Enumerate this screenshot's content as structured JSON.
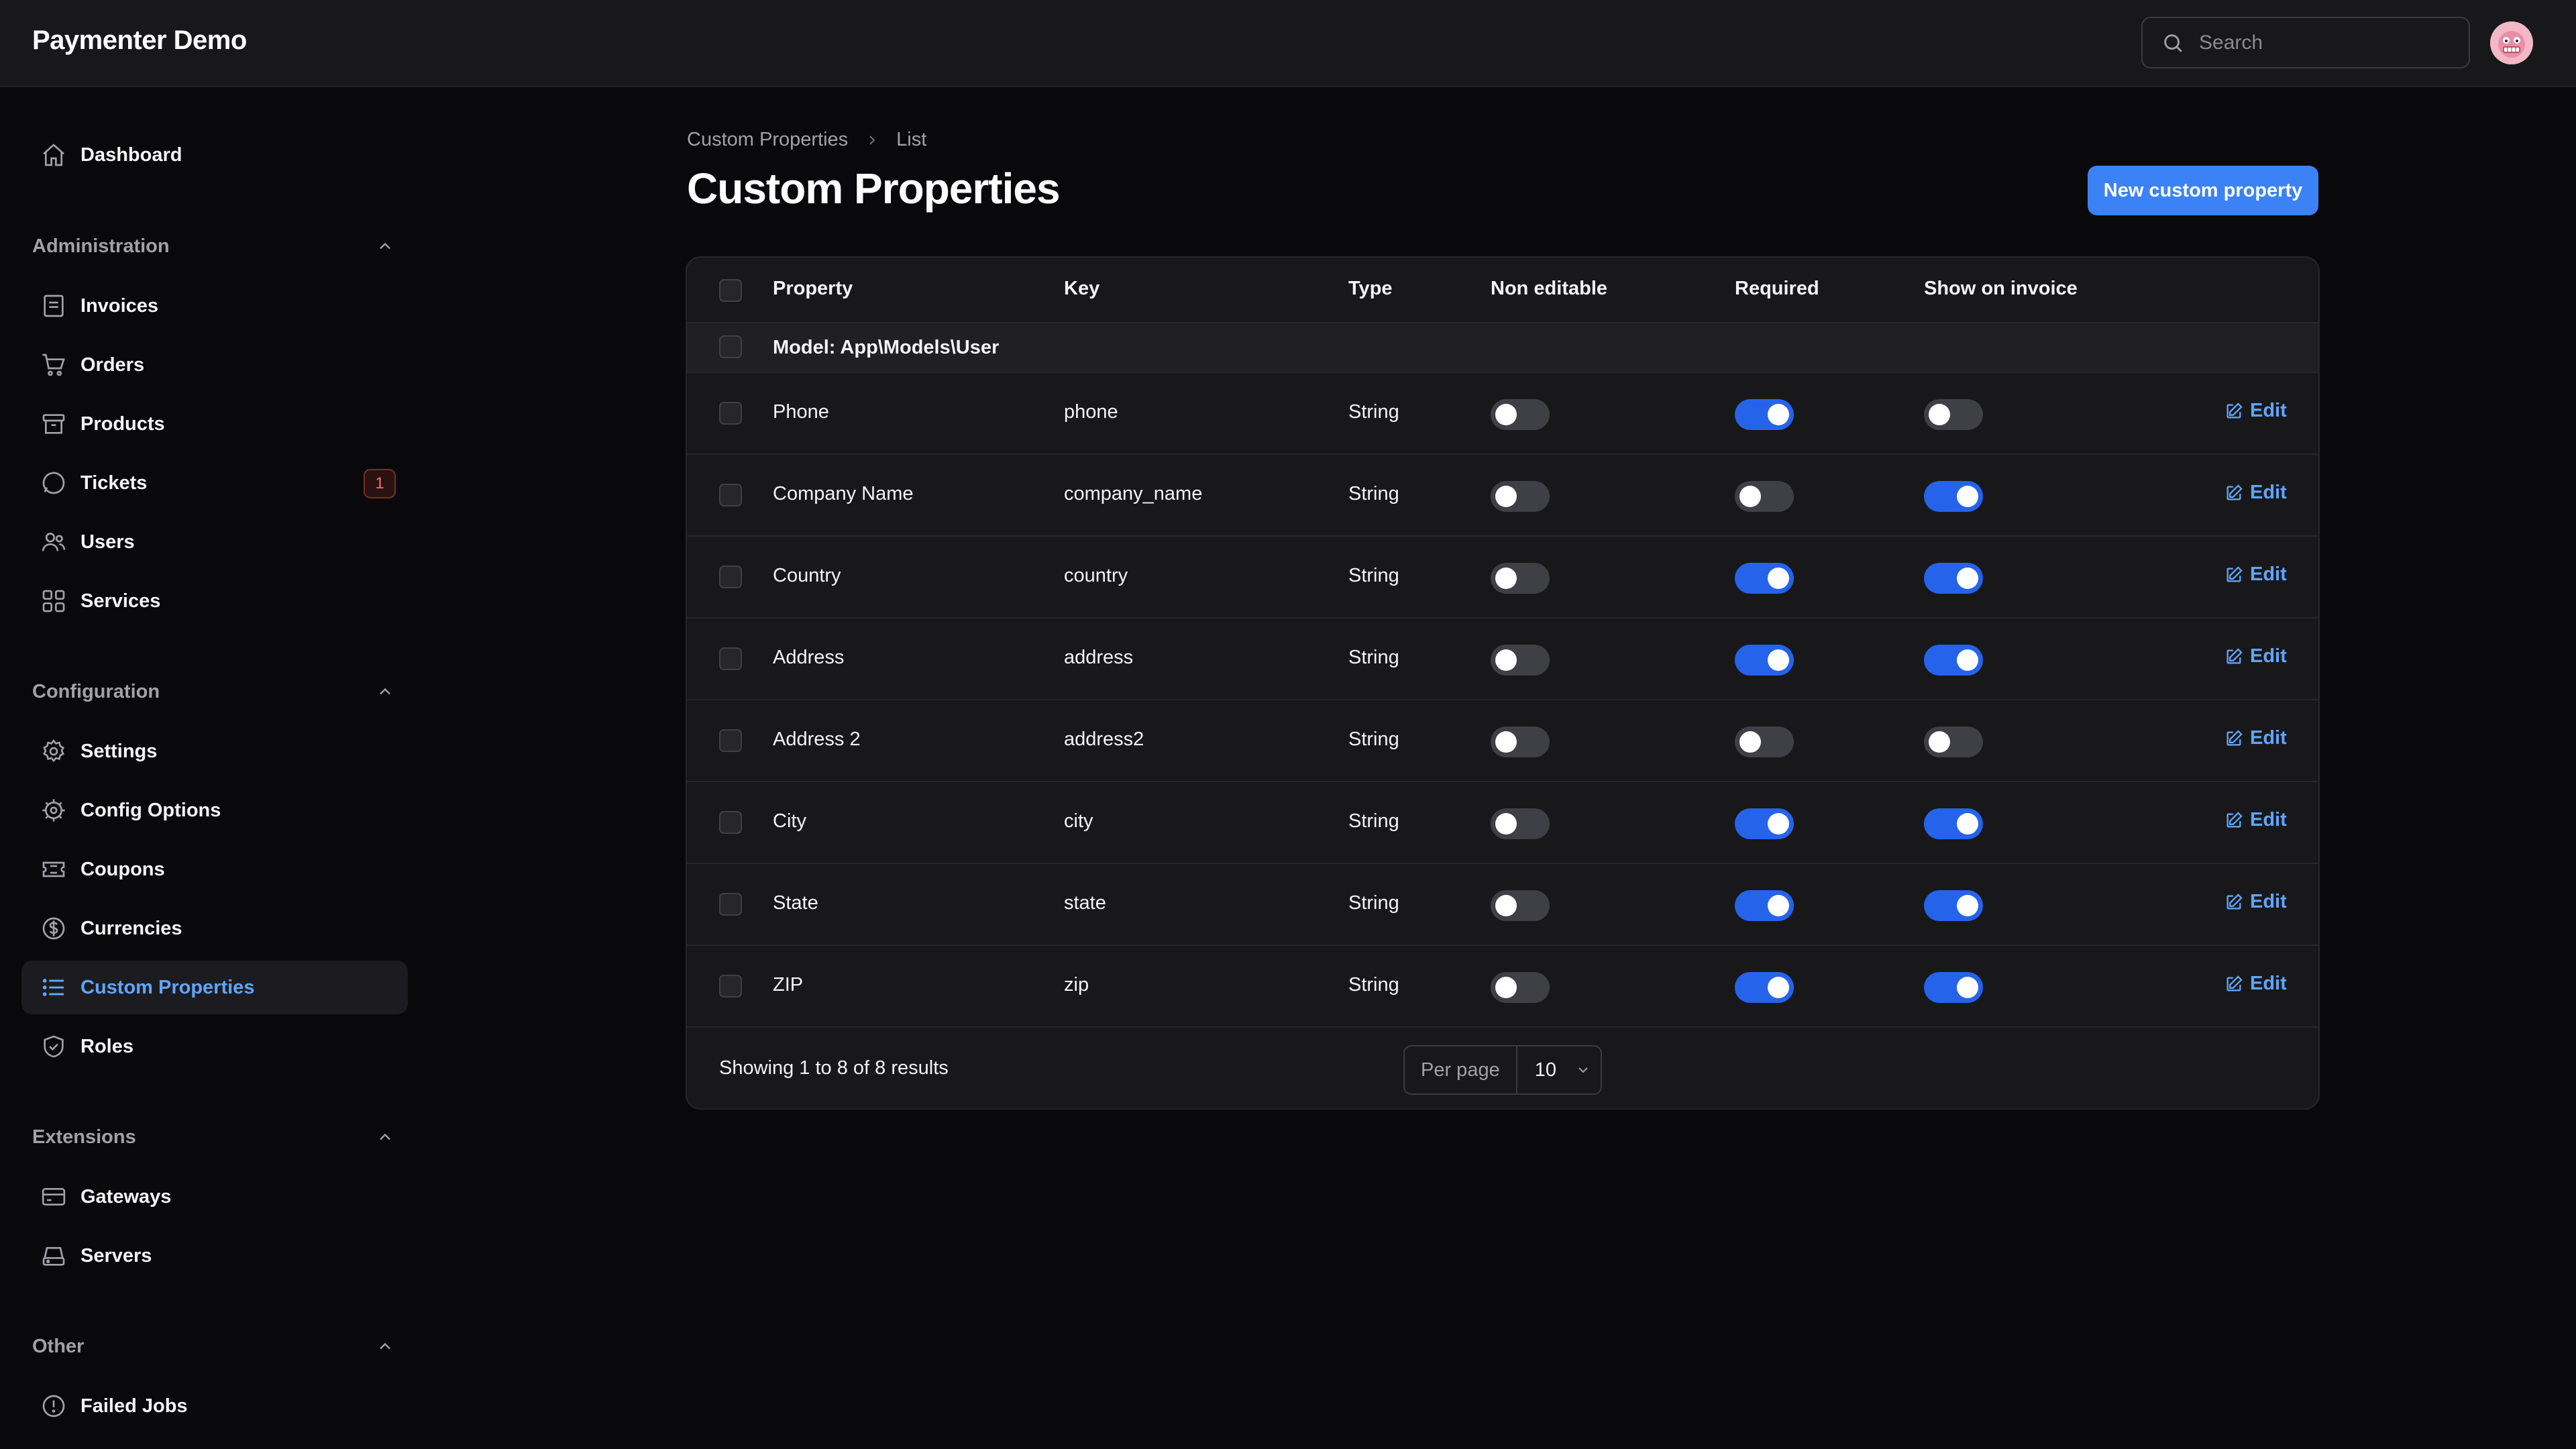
{
  "app": {
    "title": "Paymenter Demo"
  },
  "search": {
    "placeholder": "Search"
  },
  "sidebar": {
    "top": [
      {
        "label": "Dashboard",
        "icon": "home-icon"
      }
    ],
    "groups": [
      {
        "label": "Administration",
        "items": [
          {
            "label": "Invoices",
            "icon": "invoice-icon"
          },
          {
            "label": "Orders",
            "icon": "cart-icon"
          },
          {
            "label": "Products",
            "icon": "box-icon"
          },
          {
            "label": "Tickets",
            "icon": "chat-bubble-icon",
            "badge": "1"
          },
          {
            "label": "Users",
            "icon": "users-icon"
          },
          {
            "label": "Services",
            "icon": "grid-icon"
          }
        ]
      },
      {
        "label": "Configuration",
        "items": [
          {
            "label": "Settings",
            "icon": "gear-icon"
          },
          {
            "label": "Config Options",
            "icon": "cog-outline-icon"
          },
          {
            "label": "Coupons",
            "icon": "ticket-icon"
          },
          {
            "label": "Currencies",
            "icon": "dollar-circle-icon"
          },
          {
            "label": "Custom Properties",
            "icon": "list-icon",
            "active": true
          },
          {
            "label": "Roles",
            "icon": "shield-check-icon"
          }
        ]
      },
      {
        "label": "Extensions",
        "items": [
          {
            "label": "Gateways",
            "icon": "credit-card-icon"
          },
          {
            "label": "Servers",
            "icon": "server-icon"
          }
        ]
      },
      {
        "label": "Other",
        "items": [
          {
            "label": "Failed Jobs",
            "icon": "alert-circle-icon"
          }
        ]
      }
    ]
  },
  "breadcrumb": {
    "parent": "Custom Properties",
    "current": "List"
  },
  "page": {
    "title": "Custom Properties",
    "new_button": "New custom property"
  },
  "table": {
    "columns": [
      "Property",
      "Key",
      "Type",
      "Non editable",
      "Required",
      "Show on invoice"
    ],
    "group_label": "Model: App\\Models\\User",
    "edit_label": "Edit",
    "rows": [
      {
        "property": "Phone",
        "key": "phone",
        "type": "String",
        "non_editable": false,
        "required": true,
        "show_on_invoice": false
      },
      {
        "property": "Company Name",
        "key": "company_name",
        "type": "String",
        "non_editable": false,
        "required": false,
        "show_on_invoice": true
      },
      {
        "property": "Country",
        "key": "country",
        "type": "String",
        "non_editable": false,
        "required": true,
        "show_on_invoice": true
      },
      {
        "property": "Address",
        "key": "address",
        "type": "String",
        "non_editable": false,
        "required": true,
        "show_on_invoice": true
      },
      {
        "property": "Address 2",
        "key": "address2",
        "type": "String",
        "non_editable": false,
        "required": false,
        "show_on_invoice": false
      },
      {
        "property": "City",
        "key": "city",
        "type": "String",
        "non_editable": false,
        "required": true,
        "show_on_invoice": true
      },
      {
        "property": "State",
        "key": "state",
        "type": "String",
        "non_editable": false,
        "required": true,
        "show_on_invoice": true
      },
      {
        "property": "ZIP",
        "key": "zip",
        "type": "String",
        "non_editable": false,
        "required": true,
        "show_on_invoice": true
      }
    ],
    "footer": {
      "info": "Showing 1 to 8 of 8 results",
      "per_page_label": "Per page",
      "per_page_value": "10"
    }
  },
  "colors": {
    "accent": "#3b82f6",
    "toggle_on": "#2563eb",
    "toggle_off": "#3f3f46",
    "badge": "#f87171"
  }
}
